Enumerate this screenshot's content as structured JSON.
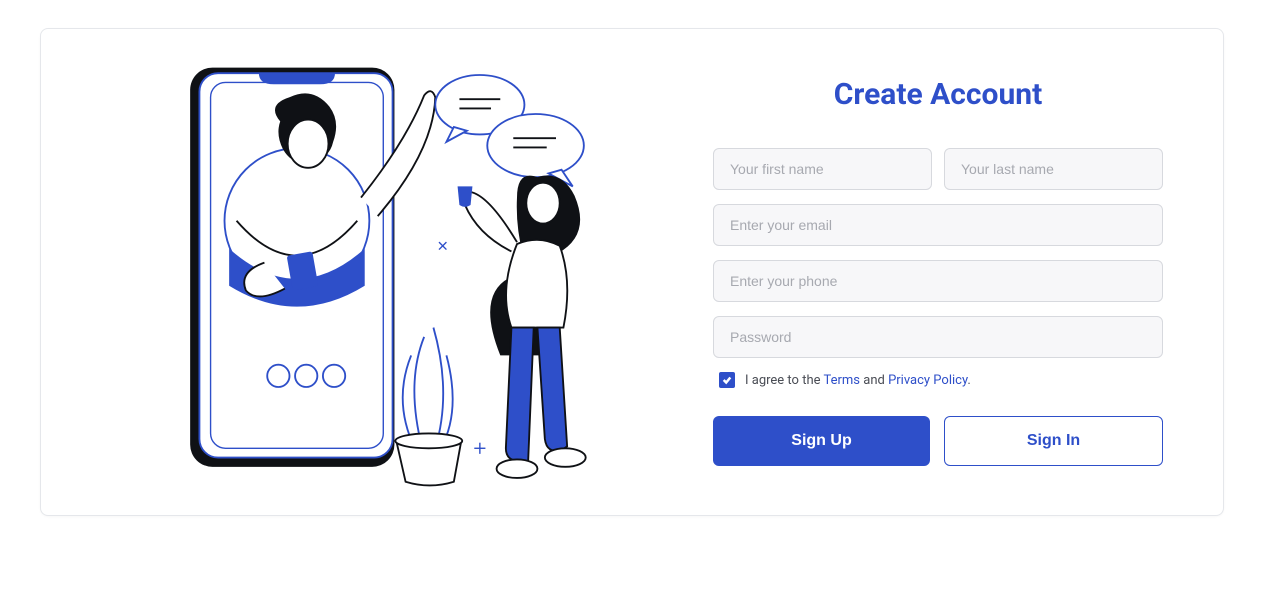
{
  "title": "Create Account",
  "fields": {
    "first_name_placeholder": "Your first name",
    "last_name_placeholder": "Your last name",
    "email_placeholder": "Enter your email",
    "phone_placeholder": "Enter your phone",
    "password_placeholder": "Password"
  },
  "agree": {
    "prefix": "I agree to the ",
    "terms": "Terms",
    "and": " and ",
    "privacy": "Privacy Policy",
    "suffix": "."
  },
  "buttons": {
    "signup": "Sign Up",
    "signin": "Sign In"
  }
}
